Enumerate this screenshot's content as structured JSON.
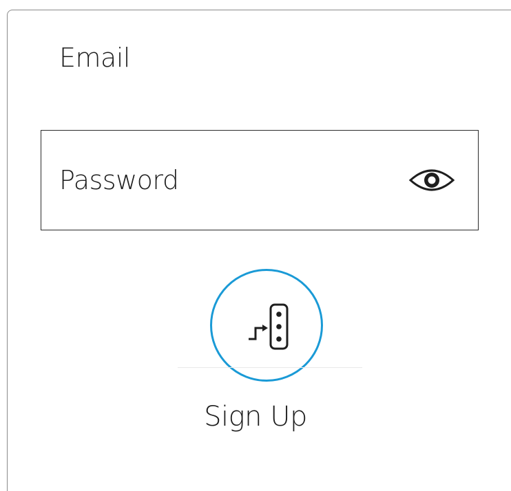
{
  "form": {
    "email_placeholder": "Email",
    "password_placeholder": "Password"
  },
  "icons": {
    "password_toggle": "eye-icon",
    "sign_up": "sign-up-steps-icon"
  },
  "signup": {
    "label": "Sign Up"
  },
  "colors": {
    "accent": "#1a9ad6",
    "text": "#1e1e1e",
    "border": "#2a2a2a"
  }
}
